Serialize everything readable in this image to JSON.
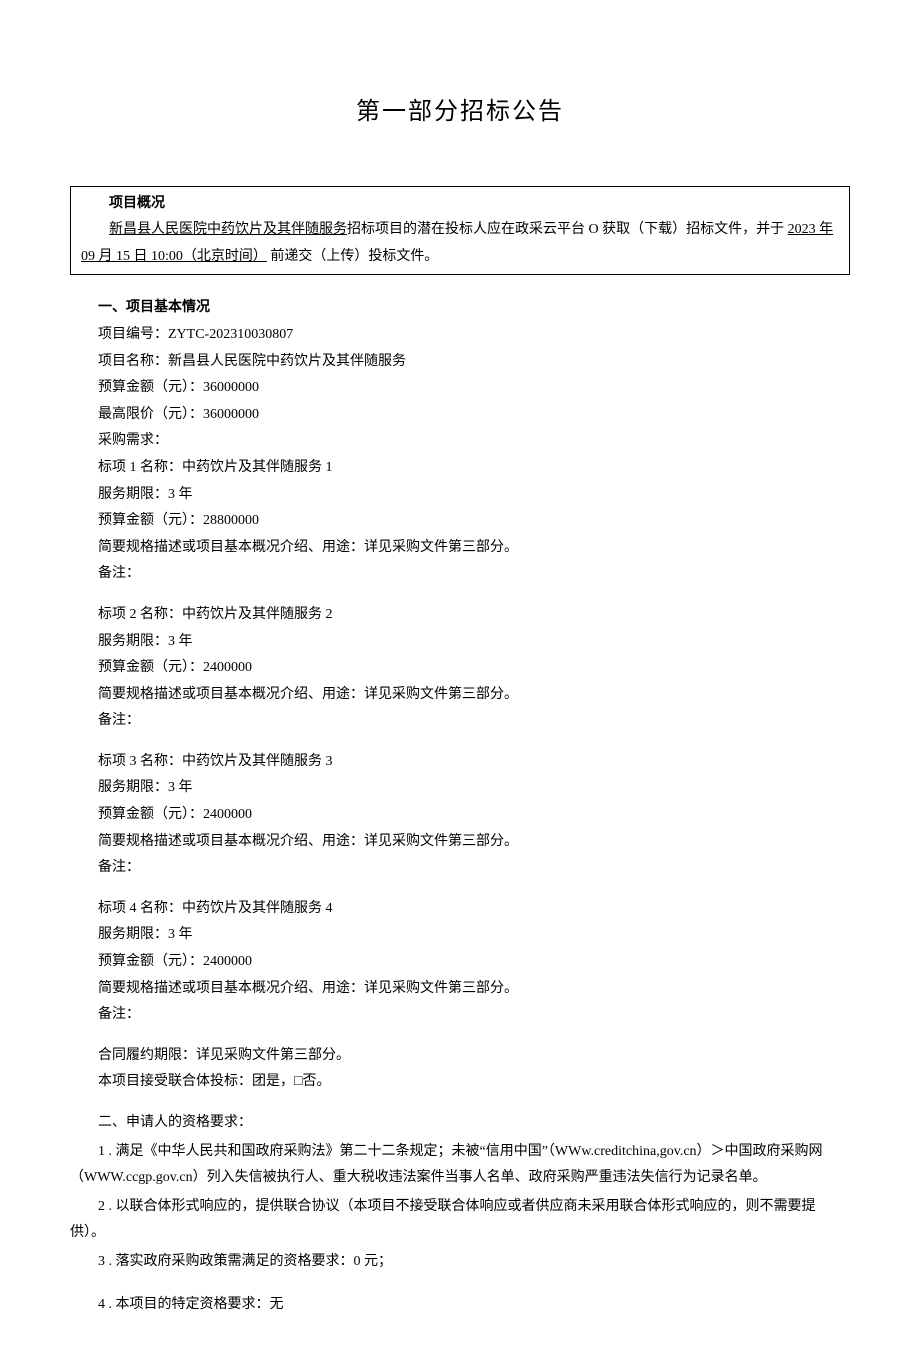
{
  "title": "第一部分招标公告",
  "box": {
    "heading": "项目概况",
    "project_title_underline": "新昌县人民医院中药饮片及其伴随服务",
    "body_part1": "招标项目的潜在投标人应在政采云平台 O 获取（下载）招标文件，并于 ",
    "deadline_underline": "2023 年 09 月 15 日 10:00（北京时间）",
    "body_part2": " 前递交（上传）投标文件。"
  },
  "section1": {
    "heading": "一、项目基本情况",
    "proj_no_label": "项目编号：",
    "proj_no": "ZYTC-202310030807",
    "proj_name_label": "项目名称：",
    "proj_name": "新昌县人民医院中药饮片及其伴随服务",
    "budget_label": "预算金额（元）：",
    "budget": "36000000",
    "maxprice_label": "最高限价（元）：",
    "maxprice": "36000000",
    "demand_label": "采购需求：",
    "items": [
      {
        "name_label": "标项 1 名称：",
        "name": "中药饮片及其伴随服务 1",
        "period_label": "服务期限：",
        "period": "3 年",
        "budget_label": "预算金额（元）：",
        "budget": "28800000",
        "desc_label": "简要规格描述或项目基本概况介绍、用途：",
        "desc": "详见采购文件第三部分。",
        "remark_label": "备注："
      },
      {
        "name_label": "标项 2 名称：",
        "name": "中药饮片及其伴随服务 2",
        "period_label": "服务期限：",
        "period": "3 年",
        "budget_label": "预算金额（元）：",
        "budget": "2400000",
        "desc_label": "简要规格描述或项目基本概况介绍、用途：",
        "desc": "详见采购文件第三部分。",
        "remark_label": "备注："
      },
      {
        "name_label": "标项 3 名称：",
        "name": "中药饮片及其伴随服务 3",
        "period_label": "服务期限：",
        "period": "3 年",
        "budget_label": "预算金额（元）：",
        "budget": "2400000",
        "desc_label": "简要规格描述或项目基本概况介绍、用途：",
        "desc": "详见采购文件第三部分。",
        "remark_label": "备注："
      },
      {
        "name_label": "标项 4 名称：",
        "name": "中药饮片及其伴随服务 4",
        "period_label": "服务期限：",
        "period": "3 年",
        "budget_label": "预算金额（元）：",
        "budget": "2400000",
        "desc_label": "简要规格描述或项目基本概况介绍、用途：",
        "desc": "详见采购文件第三部分。",
        "remark_label": "备注："
      }
    ],
    "contract_period": "合同履约期限：详见采购文件第三部分。",
    "consortium": "本项目接受联合体投标：团是，□否。"
  },
  "section2": {
    "heading": "二、申请人的资格要求：",
    "p1": "1 . 满足《中华人民共和国政府采购法》第二十二条规定；未被“信用中国”（WWw.creditchina,gov.cn）＞中国政府采购网（WWW.ccgp.gov.cn）列入失信被执行人、重大税收违法案件当事人名单、政府采购严重违法失信行为记录名单。",
    "p2": "2  . 以联合体形式响应的，提供联合协议（本项目不接受联合体响应或者供应商未采用联合体形式响应的，则不需要提供）。",
    "p3": "3  . 落实政府采购政策需满足的资格要求：0 元；",
    "p4": "4  . 本项目的特定资格要求：无"
  }
}
